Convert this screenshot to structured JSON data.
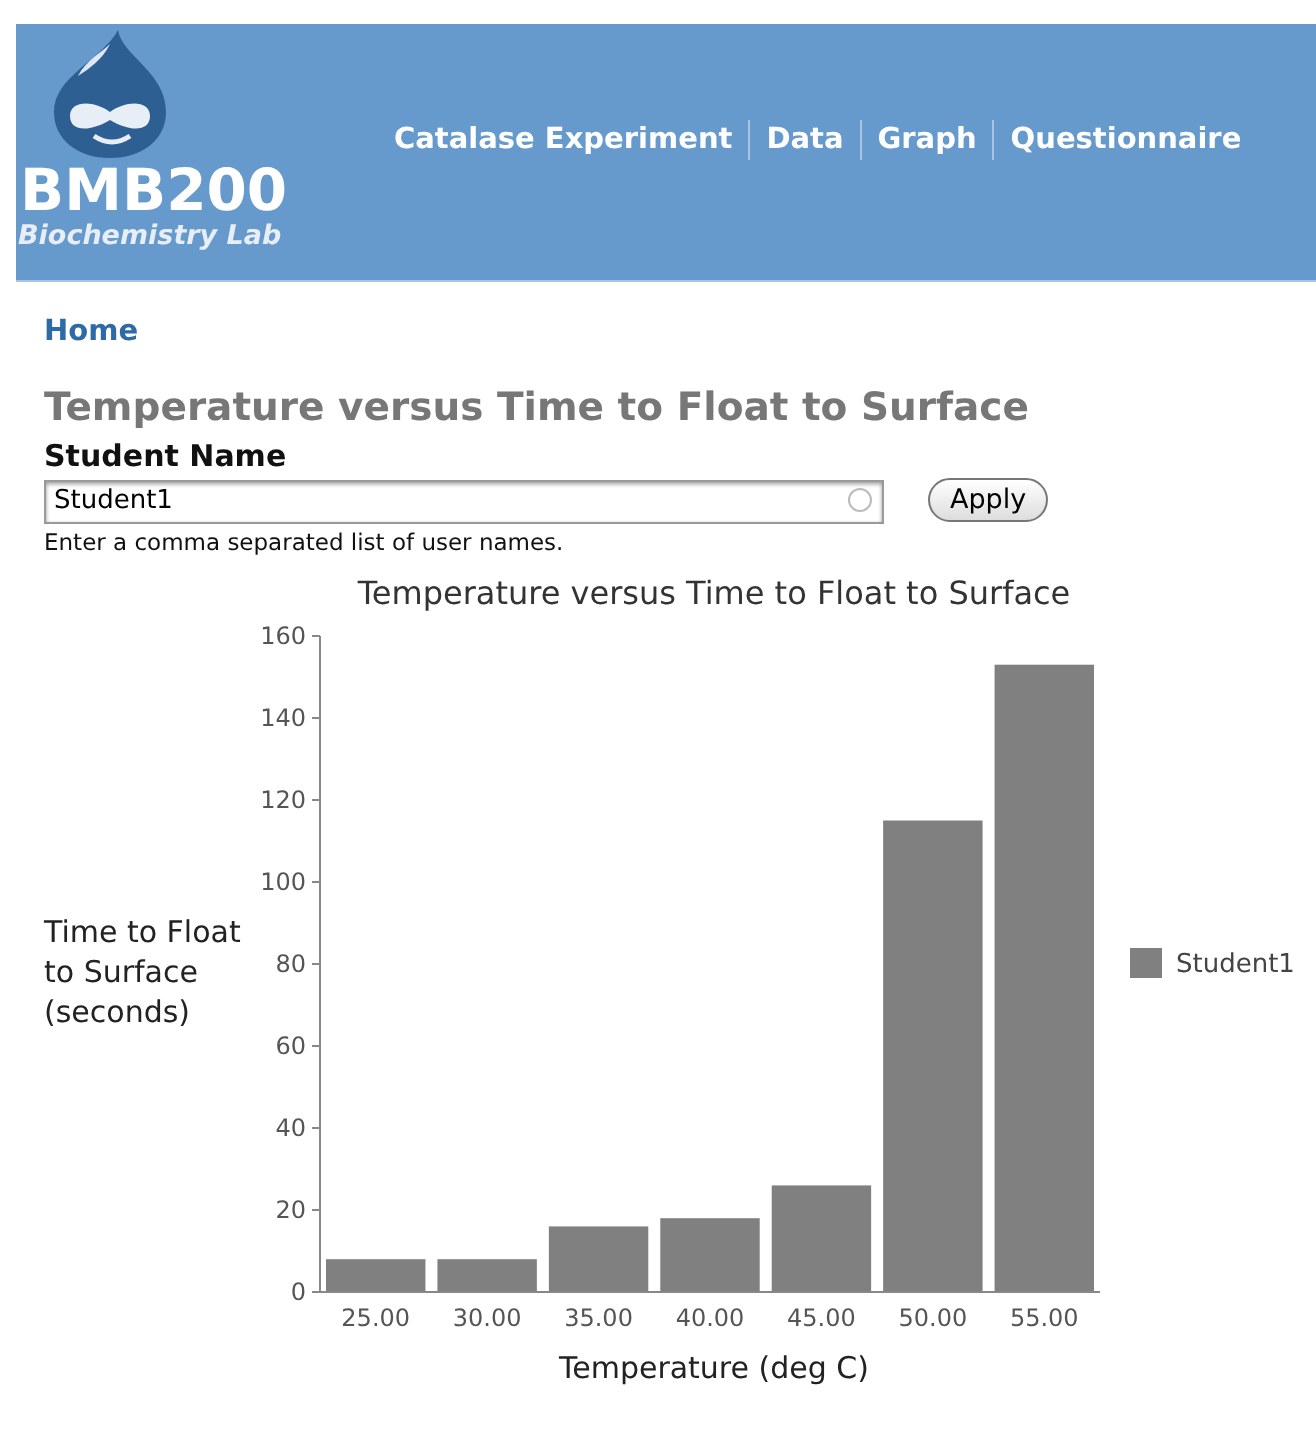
{
  "site": {
    "name": "BMB200",
    "slogan": "Biochemistry Lab"
  },
  "nav": [
    {
      "label": "Catalase Experiment"
    },
    {
      "label": "Data"
    },
    {
      "label": "Graph"
    },
    {
      "label": "Questionnaire"
    }
  ],
  "breadcrumb": "Home",
  "page_title": "Temperature versus Time to Float to Surface",
  "form": {
    "label": "Student Name",
    "value": "Student1",
    "help": "Enter a comma separated list of user names.",
    "button": "Apply"
  },
  "chart_data": {
    "type": "bar",
    "title": "Temperature versus Time to Float to Surface",
    "xlabel": "Temperature (deg C)",
    "ylabel": "Time to Float to Surface (seconds)",
    "categories": [
      "25.00",
      "30.00",
      "35.00",
      "40.00",
      "45.00",
      "50.00",
      "55.00"
    ],
    "series": [
      {
        "name": "Student1",
        "color": "#808080",
        "values": [
          8,
          8,
          16,
          18,
          26,
          115,
          153
        ]
      }
    ],
    "ylim": [
      0,
      160
    ],
    "yticks": [
      0,
      20,
      40,
      60,
      80,
      100,
      120,
      140,
      160
    ]
  }
}
